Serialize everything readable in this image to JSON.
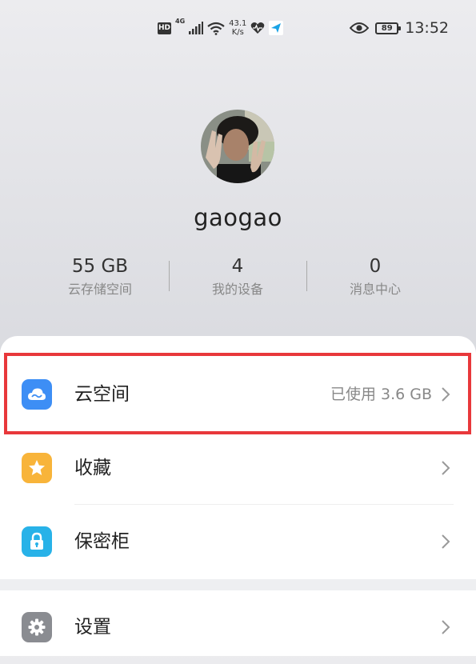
{
  "status_bar": {
    "hd": "HD",
    "network_type": "4G",
    "speed_value": "43.1",
    "speed_unit": "K/s",
    "battery_level": "89",
    "time": "13:52"
  },
  "profile": {
    "username": "gaogao"
  },
  "stats": [
    {
      "value": "55 GB",
      "label": "云存储空间"
    },
    {
      "value": "4",
      "label": "我的设备"
    },
    {
      "value": "0",
      "label": "消息中心"
    }
  ],
  "menu": {
    "cloud_space": {
      "label": "云空间",
      "value": "已使用 3.6 GB",
      "icon": "cloud-icon",
      "color": "#3d8ef5"
    },
    "favorites": {
      "label": "收藏",
      "icon": "star-icon",
      "color": "#f8b43a"
    },
    "safe": {
      "label": "保密柜",
      "icon": "lock-icon",
      "color": "#28b2e8"
    },
    "settings": {
      "label": "设置",
      "icon": "gear-icon",
      "color": "#8a8c91"
    }
  },
  "highlight_color": "#e8383b"
}
